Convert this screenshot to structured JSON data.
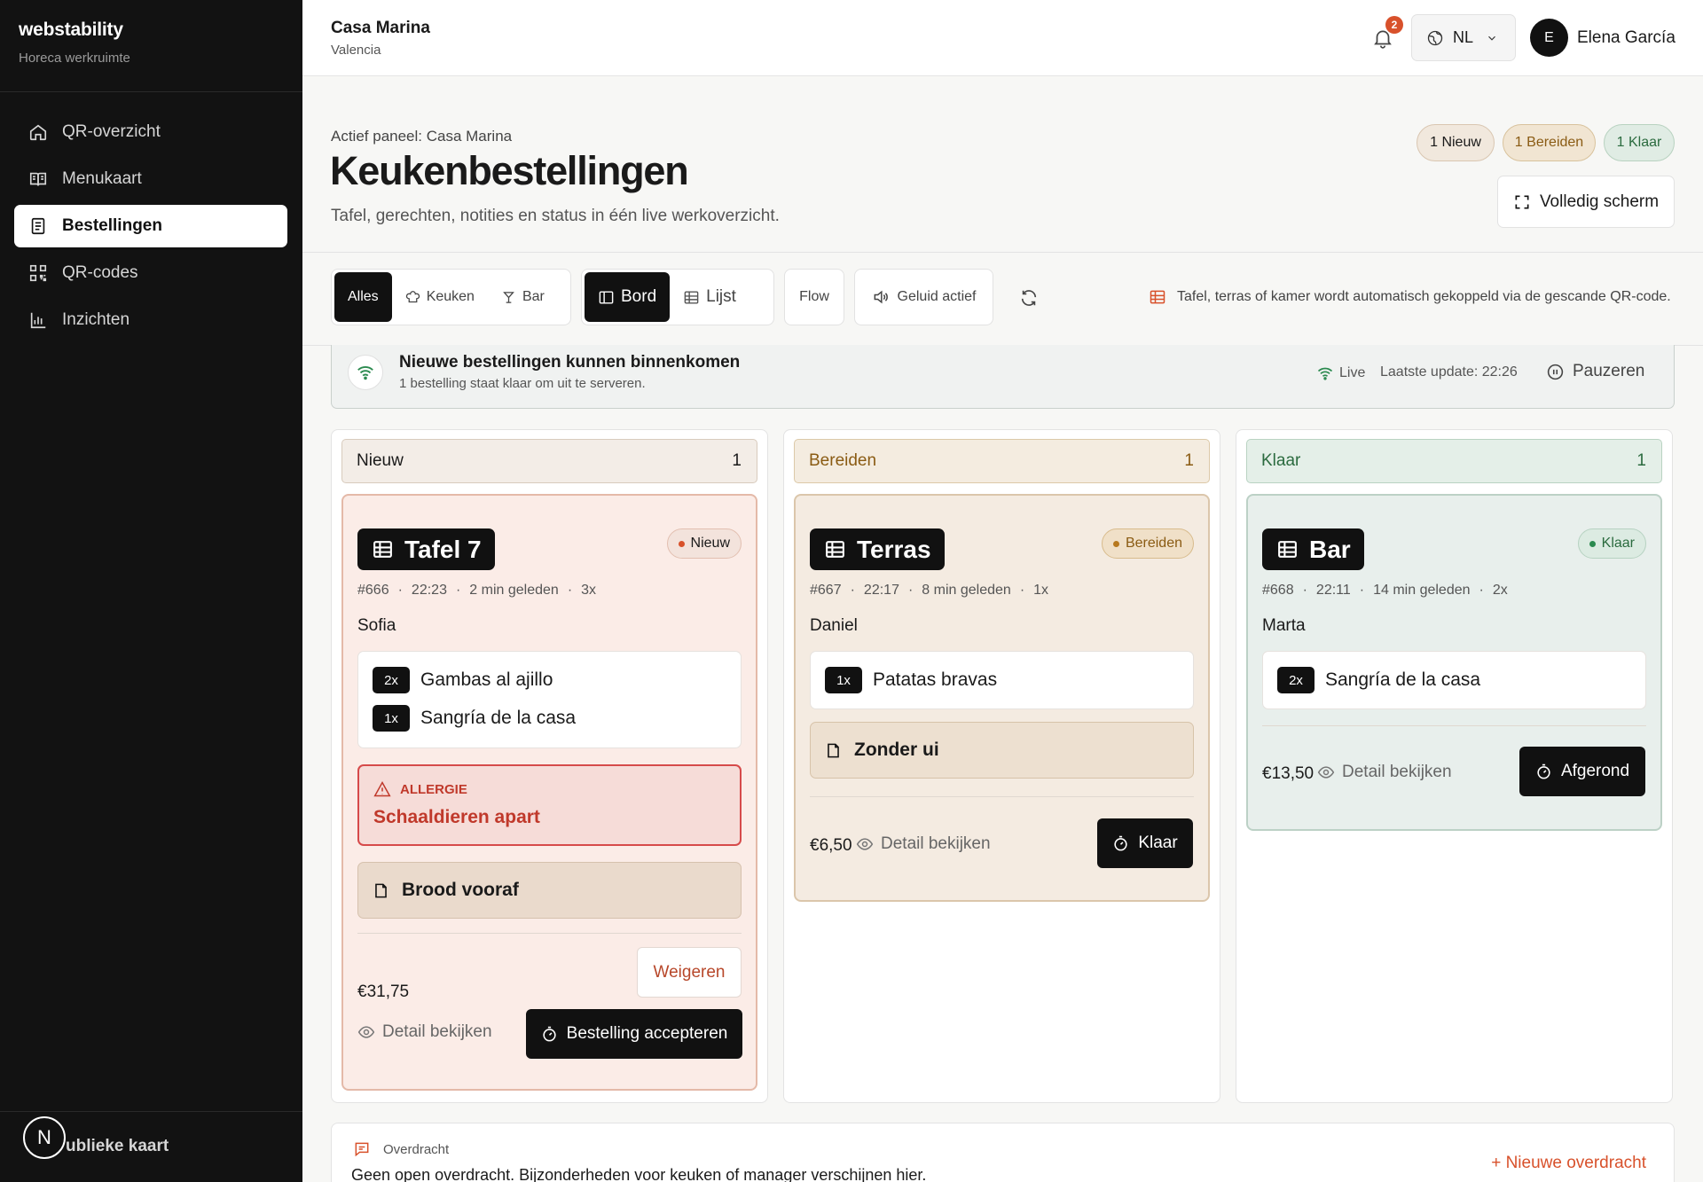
{
  "sidebar": {
    "brand": "webstability",
    "subtitle": "Horeca werkruimte",
    "items": [
      {
        "label": "QR-overzicht",
        "icon": "home-icon"
      },
      {
        "label": "Menukaart",
        "icon": "book-icon"
      },
      {
        "label": "Bestellingen",
        "icon": "receipt-icon",
        "active": true
      },
      {
        "label": "QR-codes",
        "icon": "qr-icon"
      },
      {
        "label": "Inzichten",
        "icon": "chart-icon"
      }
    ],
    "avatar_letter": "N",
    "bottom_link": "ublieke kaart"
  },
  "topbar": {
    "venue": "Casa Marina",
    "city": "Valencia",
    "notification_count": "2",
    "language": "NL",
    "user_initial": "E",
    "user_name": "Elena García"
  },
  "header": {
    "eyebrow": "Actief paneel: Casa Marina",
    "title": "Keukenbestellingen",
    "subtitle": "Tafel, gerechten, notities en status in één live werkoverzicht.",
    "pills": {
      "new": "1 Nieuw",
      "prep": "1 Bereiden",
      "done": "1 Klaar"
    },
    "fullscreen": "Volledig scherm"
  },
  "toolbar": {
    "filters": [
      "Alles",
      "Keuken",
      "Bar"
    ],
    "views": [
      "Bord",
      "Lijst"
    ],
    "flow": "Flow",
    "sound": "Geluid actief",
    "qr_hint": "Tafel, terras of kamer wordt automatisch gekoppeld via de gescande QR-code."
  },
  "banner": {
    "title": "Nieuwe bestellingen kunnen binnenkomen",
    "subtitle": "1 bestelling staat klaar om uit te serveren.",
    "live": "Live",
    "last_update": "Laatste update: 22:26",
    "pause": "Pauzeren"
  },
  "columns": [
    {
      "name": "Nieuw",
      "count": "1",
      "card": {
        "table": "Tafel 7",
        "status": "Nieuw",
        "meta": [
          "#666",
          "22:23",
          "2 min geleden",
          "3x"
        ],
        "guest": "Sofia",
        "items": [
          {
            "qty": "2x",
            "name": "Gambas al ajillo"
          },
          {
            "qty": "1x",
            "name": "Sangría de la casa"
          }
        ],
        "allergy_label": "ALLERGIE",
        "allergy_text": "Schaaldieren apart",
        "note": "Brood vooraf",
        "price": "€31,75",
        "detail": "Detail bekijken",
        "reject": "Weigeren",
        "action": "Bestelling accepteren"
      }
    },
    {
      "name": "Bereiden",
      "count": "1",
      "card": {
        "table": "Terras",
        "status": "Bereiden",
        "meta": [
          "#667",
          "22:17",
          "8 min geleden",
          "1x"
        ],
        "guest": "Daniel",
        "items": [
          {
            "qty": "1x",
            "name": "Patatas bravas"
          }
        ],
        "note": "Zonder ui",
        "price": "€6,50",
        "detail": "Detail bekijken",
        "action": "Klaar"
      }
    },
    {
      "name": "Klaar",
      "count": "1",
      "card": {
        "table": "Bar",
        "status": "Klaar",
        "meta": [
          "#668",
          "22:11",
          "14 min geleden",
          "2x"
        ],
        "guest": "Marta",
        "items": [
          {
            "qty": "2x",
            "name": "Sangría de la casa"
          }
        ],
        "price": "€13,50",
        "detail": "Detail bekijken",
        "action": "Afgerond"
      }
    }
  ],
  "handoff": {
    "label": "Overdracht",
    "text": "Geen open overdracht. Bijzonderheden voor keuken of manager verschijnen hier.",
    "new": "+ Nieuwe overdracht"
  },
  "colors": {
    "accent": "#d8512b",
    "new_bg": "#fbece7",
    "prep_text": "#8a5b13",
    "done_text": "#2b6b3f",
    "allergy": "#c0392b"
  }
}
